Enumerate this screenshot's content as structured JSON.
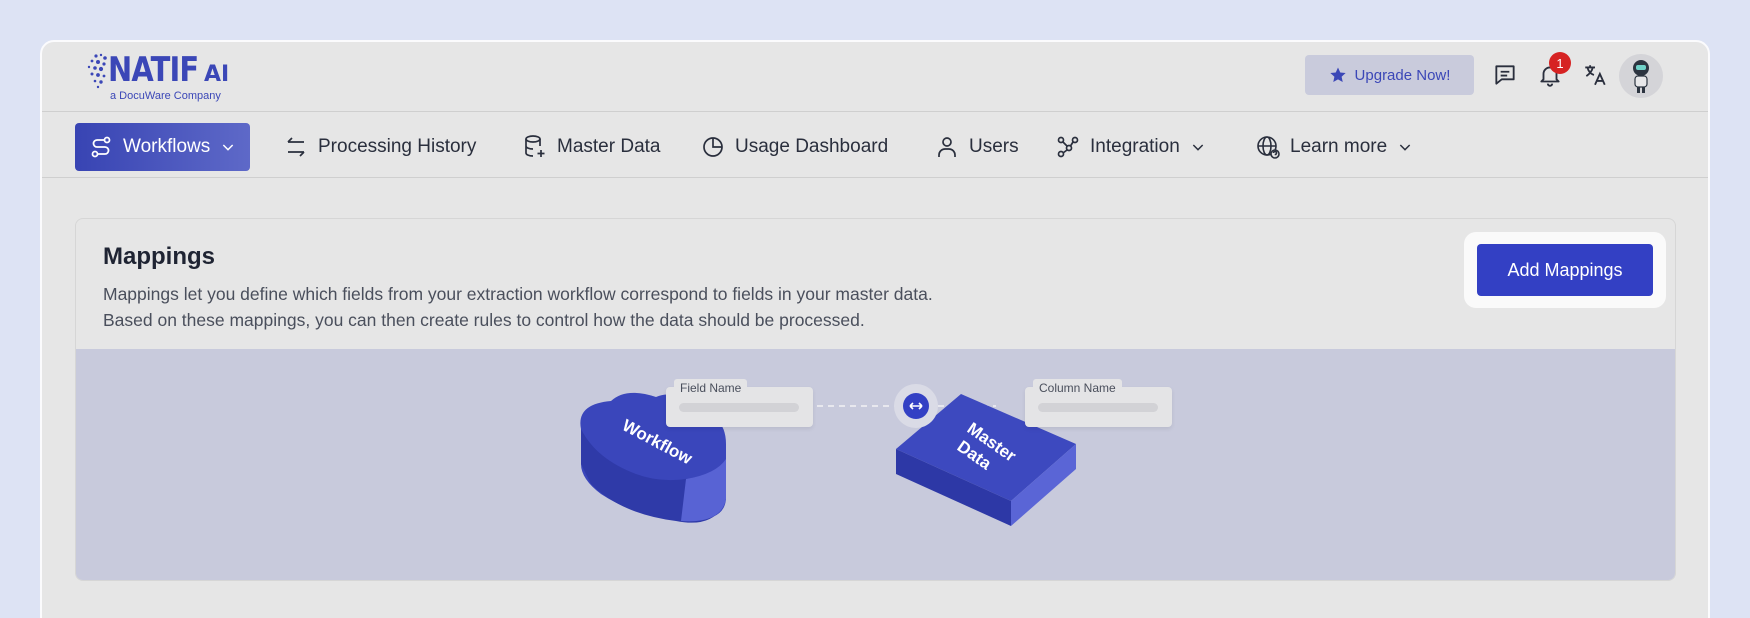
{
  "logo": {
    "main": "NATIF",
    "suffix": "AI",
    "sub": "a DocuWare Company"
  },
  "header": {
    "upgrade_label": "Upgrade Now!",
    "notifications_count": "1"
  },
  "nav": {
    "items": [
      {
        "label": "Workflows"
      },
      {
        "label": "Processing History"
      },
      {
        "label": "Master Data"
      },
      {
        "label": "Usage Dashboard"
      },
      {
        "label": "Users"
      },
      {
        "label": "Integration"
      },
      {
        "label": "Learn more"
      }
    ]
  },
  "mappings": {
    "title": "Mappings",
    "desc_line1": "Mappings let you define which fields from your extraction workflow correspond to fields in your master data.",
    "desc_line2": "Based on these mappings, you can then create rules to control how the data should be processed.",
    "add_label": "Add Mappings",
    "illustration": {
      "field_name_label": "Field Name",
      "column_name_label": "Column Name",
      "workflow_label": "Workflow",
      "master_line1": "Master",
      "master_line2": "Data"
    }
  },
  "colors": {
    "accent": "#3340c4",
    "brand": "#3b47b7",
    "badge": "#d62323"
  }
}
